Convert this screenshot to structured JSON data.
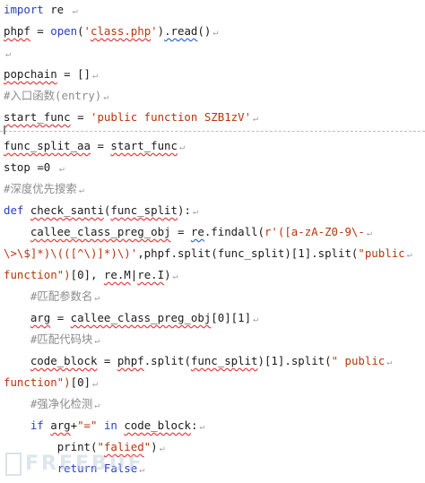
{
  "lines": [
    {
      "segs": [
        {
          "t": "import",
          "c": "kw"
        },
        {
          "t": " re "
        }
      ]
    },
    {
      "segs": [
        {
          "t": "phpf",
          "c": "wavy"
        },
        {
          "t": " = "
        },
        {
          "t": "open",
          "c": "kw"
        },
        {
          "t": "("
        },
        {
          "t": "'",
          "c": "str"
        },
        {
          "t": "class.php",
          "c": "str wavy"
        },
        {
          "t": "'",
          "c": "str"
        },
        {
          "t": ")"
        },
        {
          "t": ".read",
          "c": "wavy-blue"
        },
        {
          "t": "()"
        }
      ]
    },
    {
      "segs": []
    },
    {
      "segs": [
        {
          "t": "popchain",
          "c": "wavy"
        },
        {
          "t": " = []"
        }
      ]
    },
    {
      "segs": [
        {
          "t": "#入口函数(entry)",
          "c": "cmt"
        }
      ]
    },
    {
      "segs": [
        {
          "t": "start_func",
          "c": "wavy"
        },
        {
          "t": " = "
        },
        {
          "t": "'public function SZB1zV'",
          "c": "str"
        }
      ]
    },
    {
      "segs": [
        {
          "t": "func_split_aa",
          "c": "wavy"
        },
        {
          "t": " = "
        },
        {
          "t": "start_func",
          "c": "wavy"
        }
      ]
    },
    {
      "segs": [
        {
          "t": "stop "
        },
        {
          "t": "="
        },
        {
          "t": "0",
          "c": "num"
        },
        {
          "t": " "
        }
      ]
    },
    {
      "segs": [
        {
          "t": "#深度优先搜索",
          "c": "cmt"
        }
      ]
    },
    {
      "segs": [
        {
          "t": "def ",
          "c": "kw"
        },
        {
          "t": "check_santi",
          "c": "wavy"
        },
        {
          "t": "("
        },
        {
          "t": "func_split",
          "c": "wavy"
        },
        {
          "t": "):"
        }
      ]
    },
    {
      "segs": [
        {
          "t": "    "
        },
        {
          "t": "callee_class_preg_obj",
          "c": "wavy"
        },
        {
          "t": " = "
        },
        {
          "t": "re",
          "c": "wavy-blue"
        },
        {
          "t": ".findall("
        },
        {
          "t": "r'([a-zA-Z0-9\\-",
          "c": "str"
        }
      ]
    },
    {
      "segs": [
        {
          "t": "\\>\\$]*)\\(([^\\)]*)\\)'",
          "c": "str"
        },
        {
          "t": ",phpf.split(func_split)[1].split("
        },
        {
          "t": "\"public",
          "c": "str"
        }
      ]
    },
    {
      "segs": [
        {
          "t": "function\")",
          "c": "str"
        },
        {
          "t": "[0], "
        },
        {
          "t": "re.M",
          "c": "wavy"
        },
        {
          "t": "|"
        },
        {
          "t": "re.I",
          "c": "wavy"
        },
        {
          "t": ")"
        }
      ]
    },
    {
      "segs": [
        {
          "t": "    "
        },
        {
          "t": "#匹配参数名",
          "c": "cmt"
        }
      ]
    },
    {
      "segs": [
        {
          "t": "    "
        },
        {
          "t": "arg",
          "c": "wavy"
        },
        {
          "t": " = "
        },
        {
          "t": "callee_class_preg_obj",
          "c": "wavy"
        },
        {
          "t": "[0][1]"
        }
      ]
    },
    {
      "segs": [
        {
          "t": "    "
        },
        {
          "t": "#匹配代码块",
          "c": "cmt"
        }
      ]
    },
    {
      "segs": [
        {
          "t": "    "
        },
        {
          "t": "code_block",
          "c": "wavy"
        },
        {
          "t": " = "
        },
        {
          "t": "phpf",
          "c": "wavy"
        },
        {
          "t": ".split("
        },
        {
          "t": "func_split",
          "c": "wavy"
        },
        {
          "t": ")[1].split("
        },
        {
          "t": "\" public",
          "c": "str"
        }
      ]
    },
    {
      "segs": [
        {
          "t": "function\")",
          "c": "str"
        },
        {
          "t": "[0]"
        }
      ]
    },
    {
      "segs": [
        {
          "t": "    "
        },
        {
          "t": "#强净化检测",
          "c": "cmt"
        }
      ]
    },
    {
      "segs": [
        {
          "t": "    "
        },
        {
          "t": "if ",
          "c": "kw"
        },
        {
          "t": "arg",
          "c": "wavy"
        },
        {
          "t": "+"
        },
        {
          "t": "\"=\"",
          "c": "str"
        },
        {
          "t": " in ",
          "c": "kw"
        },
        {
          "t": "code_block",
          "c": "wavy"
        },
        {
          "t": ":"
        }
      ]
    },
    {
      "segs": [
        {
          "t": "        "
        },
        {
          "t": "print("
        },
        {
          "t": "\"",
          "c": "str"
        },
        {
          "t": "falied",
          "c": "str wavy"
        },
        {
          "t": "\"",
          "c": "str"
        },
        {
          "t": ")"
        }
      ]
    },
    {
      "segs": [
        {
          "t": "        "
        },
        {
          "t": "return ",
          "c": "kw"
        },
        {
          "t": "False",
          "c": "kw"
        }
      ]
    }
  ],
  "paragraph_mark": "↵",
  "watermark": "FREEBUF"
}
